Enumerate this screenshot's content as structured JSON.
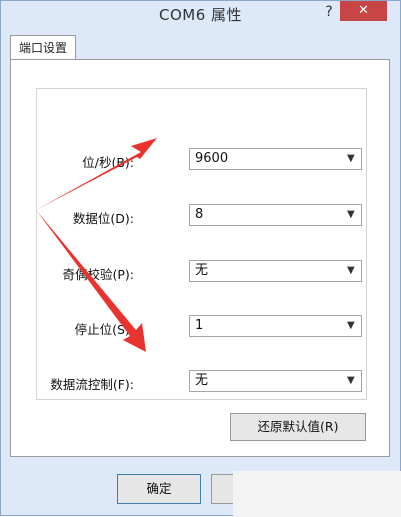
{
  "window": {
    "title": "COM6 属性",
    "help_label": "?",
    "close_label": "✕"
  },
  "tabs": [
    {
      "label": "端口设置"
    }
  ],
  "fields": [
    {
      "label": "位/秒(B):",
      "value": "9600"
    },
    {
      "label": "数据位(D):",
      "value": "8"
    },
    {
      "label": "奇偶校验(P):",
      "value": "无"
    },
    {
      "label": "停止位(S):",
      "value": "1"
    },
    {
      "label": "数据流控制(F):",
      "value": "无"
    }
  ],
  "buttons": {
    "restore": "还原默认值(R)",
    "ok": "确定"
  },
  "icons": {
    "dropdown": "chevron-down-icon"
  },
  "colors": {
    "arrow": "#e8332f",
    "close": "#c74545",
    "frame": "#dde9f8"
  }
}
